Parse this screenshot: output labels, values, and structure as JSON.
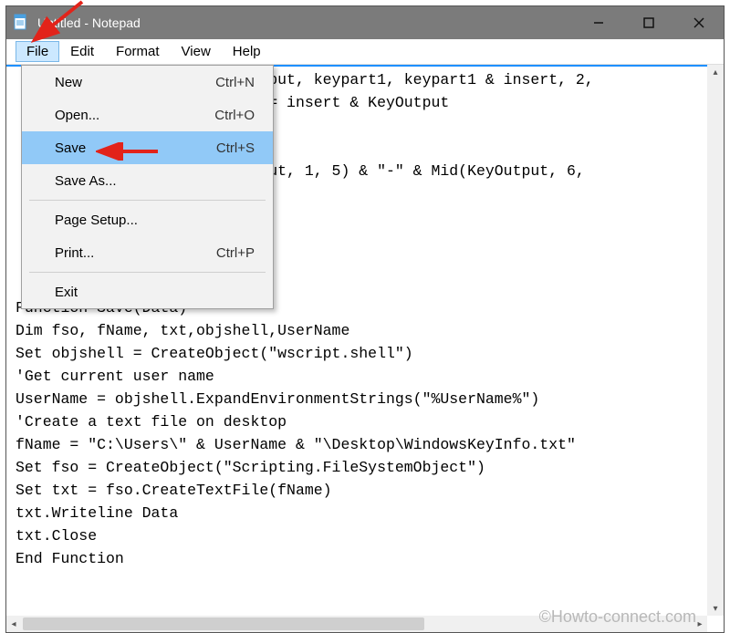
{
  "titlebar": {
    "title": "Untitled - Notepad"
  },
  "menubar": {
    "items": [
      "File",
      "Edit",
      "Format",
      "View",
      "Help"
    ]
  },
  "file_menu": {
    "items": [
      {
        "label": "New",
        "shortcut": "Ctrl+N"
      },
      {
        "label": "Open...",
        "shortcut": "Ctrl+O"
      },
      {
        "label": "Save",
        "shortcut": "Ctrl+S",
        "highlighted": true
      },
      {
        "label": "Save As...",
        "shortcut": ""
      },
      {
        "sep": true
      },
      {
        "label": "Page Setup...",
        "shortcut": ""
      },
      {
        "label": "Print...",
        "shortcut": "Ctrl+P"
      },
      {
        "sep": true
      },
      {
        "label": "Exit",
        "shortcut": ""
      }
    ]
  },
  "editor": {
    "lines": [
      "                         Output, keypart1, keypart1 & insert, 2,",
      "                         ut = insert & KeyOutput",
      "",
      "",
      "                         utput, 1, 5) & \"-\" & Mid(KeyOutput, 6,",
      "",
      "",
      "",
      "",
      "",
      "Function Save(Data)",
      "Dim fso, fName, txt,objshell,UserName",
      "Set objshell = CreateObject(\"wscript.shell\")",
      "'Get current user name",
      "UserName = objshell.ExpandEnvironmentStrings(\"%UserName%\")",
      "'Create a text file on desktop",
      "fName = \"C:\\Users\\\" & UserName & \"\\Desktop\\WindowsKeyInfo.txt\"",
      "Set fso = CreateObject(\"Scripting.FileSystemObject\")",
      "Set txt = fso.CreateTextFile(fName)",
      "txt.Writeline Data",
      "txt.Close",
      "End Function"
    ]
  },
  "watermark": "©Howto-connect.com"
}
